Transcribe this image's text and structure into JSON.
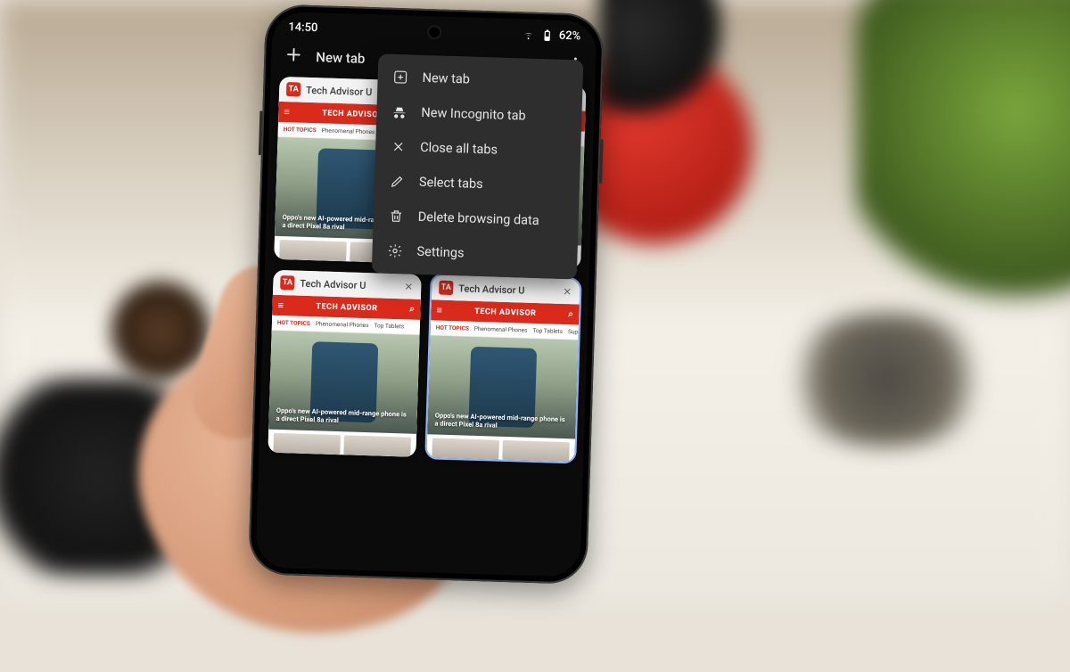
{
  "status": {
    "time": "14:50",
    "battery": "62%"
  },
  "header": {
    "new_tab_label": "New tab"
  },
  "menu": {
    "items": [
      {
        "label": "New tab"
      },
      {
        "label": "New Incognito tab"
      },
      {
        "label": "Close all tabs"
      },
      {
        "label": "Select tabs"
      },
      {
        "label": "Delete browsing data"
      },
      {
        "label": "Settings"
      }
    ]
  },
  "tabs": [
    {
      "title": "Tech Advisor U",
      "favicon": "TA"
    },
    {
      "title": "Tech Advisor U",
      "favicon": "TA"
    },
    {
      "title": "Tech Advisor U",
      "favicon": "TA"
    },
    {
      "title": "Tech Advisor U",
      "favicon": "TA"
    }
  ],
  "preview": {
    "brand": "TECH ADVISOR",
    "topics_label": "HOT TOPICS",
    "topics": [
      "Phenomenal Phones",
      "Top Tablets",
      "Superb Sou"
    ],
    "hero_headline": "Oppo's new AI-powered mid-range phone is a direct Pixel 8a rival"
  },
  "colors": {
    "accent": "#d92a1c",
    "menu_bg": "#2e2e2e",
    "active_outline": "#8ab4f8"
  }
}
